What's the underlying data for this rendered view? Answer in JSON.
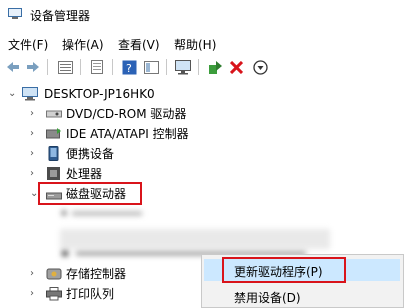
{
  "window": {
    "title": "设备管理器"
  },
  "menu": [
    {
      "label": "文件(F)"
    },
    {
      "label": "操作(A)"
    },
    {
      "label": "查看(V)"
    },
    {
      "label": "帮助(H)"
    }
  ],
  "toolbar": {
    "buttons": [
      "back-arrow-icon",
      "forward-arrow-icon",
      "properties-icon",
      "list-icon",
      "help-icon",
      "view-icon",
      "monitor-icon",
      "update-driver-icon",
      "uninstall-icon",
      "download-icon"
    ]
  },
  "tree": {
    "root": "DESKTOP-JP16HK0",
    "items": [
      {
        "label": "DVD/CD-ROM 驱动器"
      },
      {
        "label": "IDE ATA/ATAPI 控制器"
      },
      {
        "label": "便携设备"
      },
      {
        "label": "处理器"
      },
      {
        "label": "磁盘驱动器"
      },
      {
        "label": "存储控制器"
      },
      {
        "label": "打印队列"
      }
    ]
  },
  "context_menu": {
    "items": [
      {
        "label": "更新驱动程序(P)"
      },
      {
        "label": "禁用设备(D)"
      }
    ]
  },
  "colors": {
    "highlight": "#d9141b",
    "selection": "#cce8ff"
  }
}
